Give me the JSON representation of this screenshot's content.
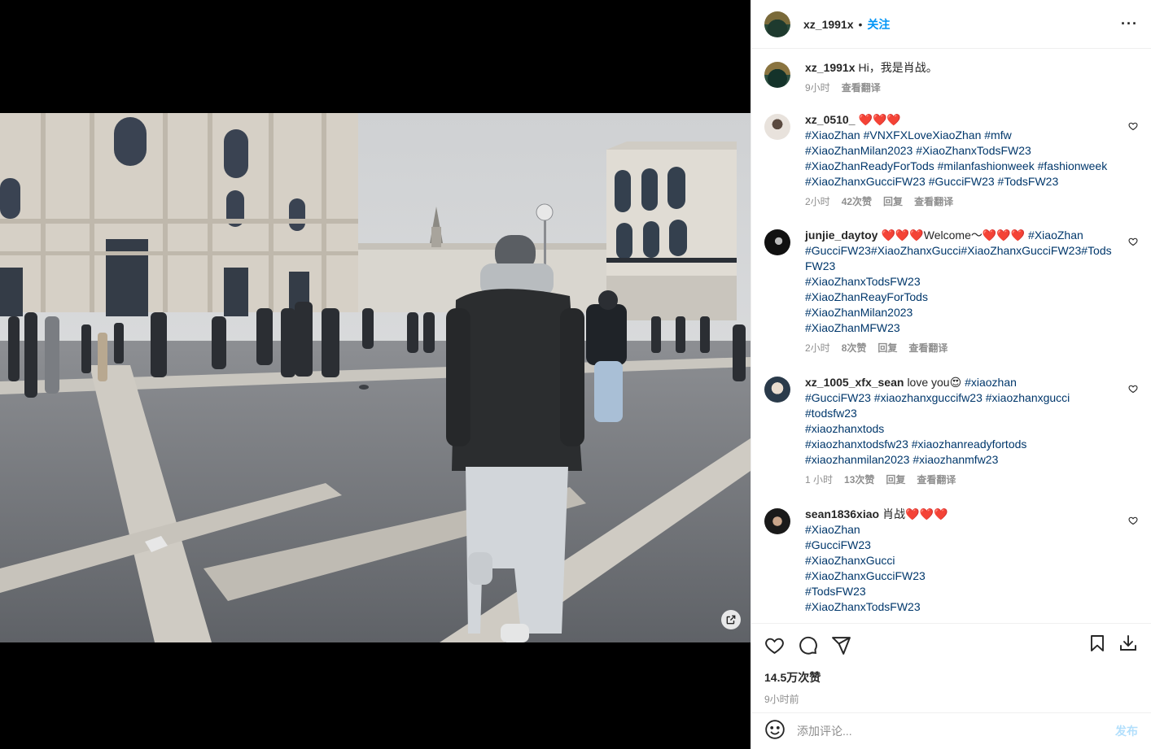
{
  "post": {
    "username": "xz_1991x",
    "dot": "•",
    "follow_label": "关注",
    "more_label": "···",
    "caption": {
      "username": "xz_1991x",
      "text": "Hi，我是肖战。",
      "time": "9小时",
      "translate": "查看翻译"
    }
  },
  "comments": [
    {
      "username": "xz_0510_",
      "lines": [
        {
          "text": "❤️❤️❤️",
          "tag": false
        },
        {
          "text": "#XiaoZhan #VNXFXLoveXiaoZhan #mfw",
          "tag": true
        },
        {
          "text": "#XiaoZhanMilan2023 #XiaoZhanxTodsFW23",
          "tag": true
        },
        {
          "text": "#XiaoZhanReadyForTods #milanfashionweek #fashionweek",
          "tag": true
        },
        {
          "text": "#XiaoZhanxGucciFW23 #GucciFW23 #TodsFW23",
          "tag": true
        }
      ],
      "time": "2小时",
      "likes": "42次赞",
      "reply": "回复",
      "translate": "查看翻译"
    },
    {
      "username": "junjie_daytoy",
      "first_plain": "❤️❤️❤️Welcome～❤️❤️❤️",
      "first_tag": "#XiaoZhan",
      "lines": [
        {
          "text": "#GucciFW23#XiaoZhanxGucci#XiaoZhanxGucciFW23#Tods",
          "tag": true
        },
        {
          "text": "FW23",
          "tag": true
        },
        {
          "text": "#XiaoZhanxTodsFW23",
          "tag": true
        },
        {
          "text": "#XiaoZhanReayForTods",
          "tag": true
        },
        {
          "text": "#XiaoZhanMilan2023",
          "tag": true
        },
        {
          "text": "#XiaoZhanMFW23",
          "tag": true
        }
      ],
      "time": "2小时",
      "likes": "8次赞",
      "reply": "回复",
      "translate": "查看翻译"
    },
    {
      "username": "xz_1005_xfx_sean",
      "first_plain": "love you😍",
      "first_tag": "#xiaozhan",
      "lines": [
        {
          "text": "#GucciFW23 #xiaozhanxguccifw23 #xiaozhanxgucci",
          "tag": true
        },
        {
          "text": "#todsfw23",
          "tag": true
        },
        {
          "text": "#xiaozhanxtods",
          "tag": true
        },
        {
          "text": "#xiaozhanxtodsfw23 #xiaozhanreadyfortods",
          "tag": true
        },
        {
          "text": "#xiaozhanmilan2023 #xiaozhanmfw23",
          "tag": true
        }
      ],
      "time": "1 小时",
      "likes": "13次赞",
      "reply": "回复",
      "translate": "查看翻译"
    },
    {
      "username": "sean1836xiao",
      "first_plain": "肖战❤️❤️❤️",
      "lines": [
        {
          "text": "#XiaoZhan",
          "tag": true
        },
        {
          "text": "#GucciFW23",
          "tag": true
        },
        {
          "text": "#XiaoZhanxGucci",
          "tag": true
        },
        {
          "text": "#XiaoZhanxGucciFW23",
          "tag": true
        },
        {
          "text": "#TodsFW23",
          "tag": true
        },
        {
          "text": "#XiaoZhanxTodsFW23",
          "tag": true
        }
      ]
    }
  ],
  "footer": {
    "likes": "14.5万次赞",
    "time": "9小时前",
    "add_comment_placeholder": "添加评论...",
    "post_label": "发布"
  },
  "icons": {
    "like": "heart-icon",
    "comment": "comment-icon",
    "share": "share-icon",
    "save": "bookmark-icon",
    "download": "download-icon",
    "emoji": "emoji-icon",
    "open": "open-external-icon"
  },
  "colors": {
    "link": "#0095f6",
    "hashtag": "#00376b",
    "muted": "#8e8e8e",
    "heart": "#e0245e"
  }
}
